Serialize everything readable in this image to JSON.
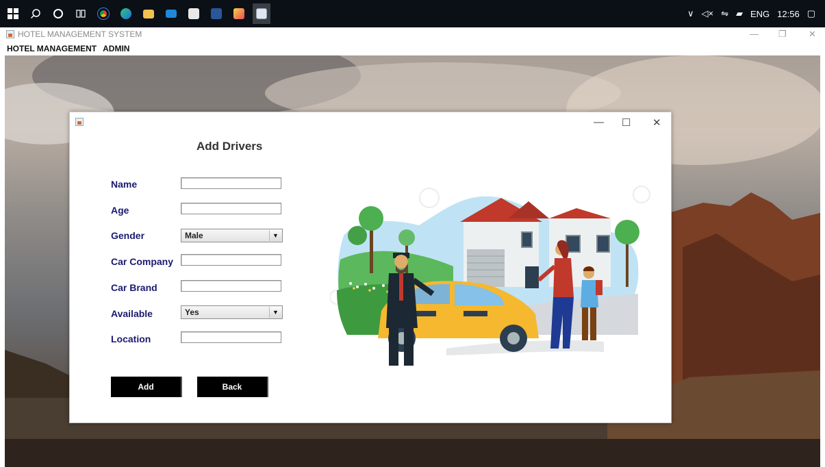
{
  "taskbar": {
    "icons": [
      "windows-start",
      "search",
      "cortana",
      "task-view",
      "chrome",
      "edge",
      "file-explorer",
      "mail",
      "store",
      "word",
      "app",
      "java"
    ],
    "language": "ENG",
    "time": "12:56",
    "colors": {
      "background": "#0b1017"
    }
  },
  "app_window": {
    "title": "HOTEL MANAGEMENT SYSTEM",
    "menu": [
      "HOTEL MANAGEMENT",
      "ADMIN"
    ]
  },
  "dialog": {
    "title": "Add Drivers",
    "fields": [
      {
        "label": "Name",
        "type": "text",
        "value": ""
      },
      {
        "label": "Age",
        "type": "text",
        "value": ""
      },
      {
        "label": "Gender",
        "type": "select",
        "value": "Male"
      },
      {
        "label": "Car Company",
        "type": "text",
        "value": ""
      },
      {
        "label": "Car Brand",
        "type": "text",
        "value": ""
      },
      {
        "label": "Available",
        "type": "select",
        "value": "Yes"
      },
      {
        "label": "Location",
        "type": "text",
        "value": ""
      }
    ],
    "buttons": {
      "add": "Add",
      "back": "Back"
    },
    "colors": {
      "label": "#1a1a6e",
      "button_bg": "#000000",
      "button_text": "#ffffff"
    }
  }
}
